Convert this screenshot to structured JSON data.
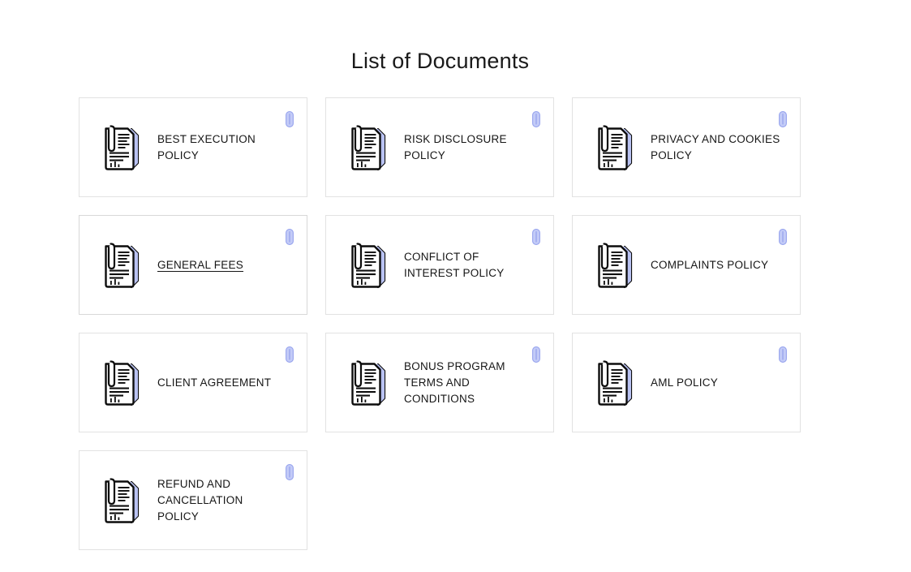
{
  "header": {
    "title": "List of Documents"
  },
  "colors": {
    "page_background": "#ffffff",
    "card_border": "#e2e2e2",
    "text": "#161616",
    "title_text": "#1a1a1a",
    "clip_badge": "#a3b0f0",
    "icon_outline": "#0d0d0d",
    "icon_back_page": "#b9c2f2"
  },
  "icons": {
    "document": "document-with-paperclip-icon",
    "badge": "paperclip-icon"
  },
  "documents": [
    {
      "id": "best-execution-policy",
      "label": "BEST EXECUTION POLICY",
      "active": false
    },
    {
      "id": "risk-disclosure-policy",
      "label": "RISK DISCLOSURE POLICY",
      "active": false
    },
    {
      "id": "privacy-and-cookies-policy",
      "label": "PRIVACY AND COOKIES POLICY",
      "active": false
    },
    {
      "id": "general-fees",
      "label": "GENERAL FEES",
      "active": true
    },
    {
      "id": "conflict-of-interest-policy",
      "label": "CONFLICT OF INTEREST POLICY",
      "active": false
    },
    {
      "id": "complaints-policy",
      "label": "COMPLAINTS POLICY",
      "active": false
    },
    {
      "id": "client-agreement",
      "label": "CLIENT AGREEMENT",
      "active": false
    },
    {
      "id": "bonus-program-terms",
      "label": "BONUS PROGRAM TERMS AND CONDITIONS",
      "active": false
    },
    {
      "id": "aml-policy",
      "label": "AML POLICY",
      "active": false
    },
    {
      "id": "refund-and-cancellation-policy",
      "label": "REFUND AND CANCELLATION POLICY",
      "active": false
    }
  ]
}
